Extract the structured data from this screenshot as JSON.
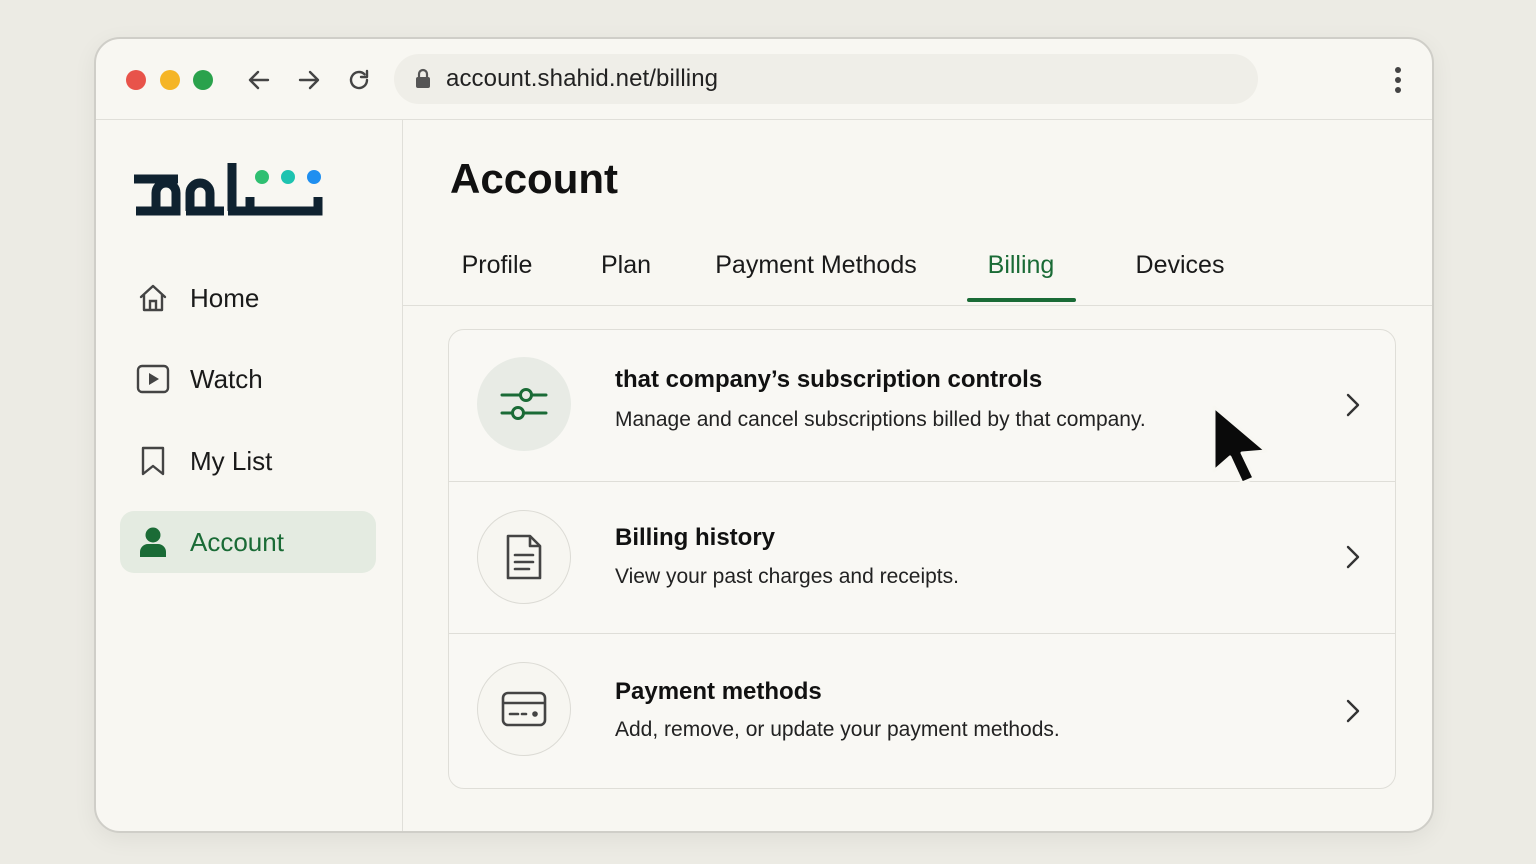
{
  "browser": {
    "url": "account.shahid.net/billing"
  },
  "sidebar": {
    "items": [
      {
        "label": "Home",
        "icon": "home-icon",
        "active": false
      },
      {
        "label": "Watch",
        "icon": "play-icon",
        "active": false
      },
      {
        "label": "My List",
        "icon": "bookmark-icon",
        "active": false
      },
      {
        "label": "Account",
        "icon": "user-icon",
        "active": true
      }
    ]
  },
  "main": {
    "title": "Account",
    "tabs": [
      {
        "label": "Profile",
        "active": false
      },
      {
        "label": "Plan",
        "active": false
      },
      {
        "label": "Payment Methods",
        "active": false
      },
      {
        "label": "Billing",
        "active": true
      },
      {
        "label": "Devices",
        "active": false
      }
    ],
    "rows": [
      {
        "title": "that company’s subscription controls",
        "description": "Manage and cancel subscriptions billed by that company.",
        "icon": "sliders-icon"
      },
      {
        "title": "Billing history",
        "description": "View your past charges and receipts.",
        "icon": "document-icon"
      },
      {
        "title": "Payment methods",
        "description": "Add, remove, or update your payment methods.",
        "icon": "credit-card-icon"
      }
    ]
  },
  "colors": {
    "accent": "#1a6b36",
    "active_bg": "#e4ebe1",
    "logo_dark": "#0f2230",
    "logo_dot_green": "#2fbf71",
    "logo_dot_teal": "#1ec3b0",
    "logo_dot_blue": "#1f8ff0"
  }
}
